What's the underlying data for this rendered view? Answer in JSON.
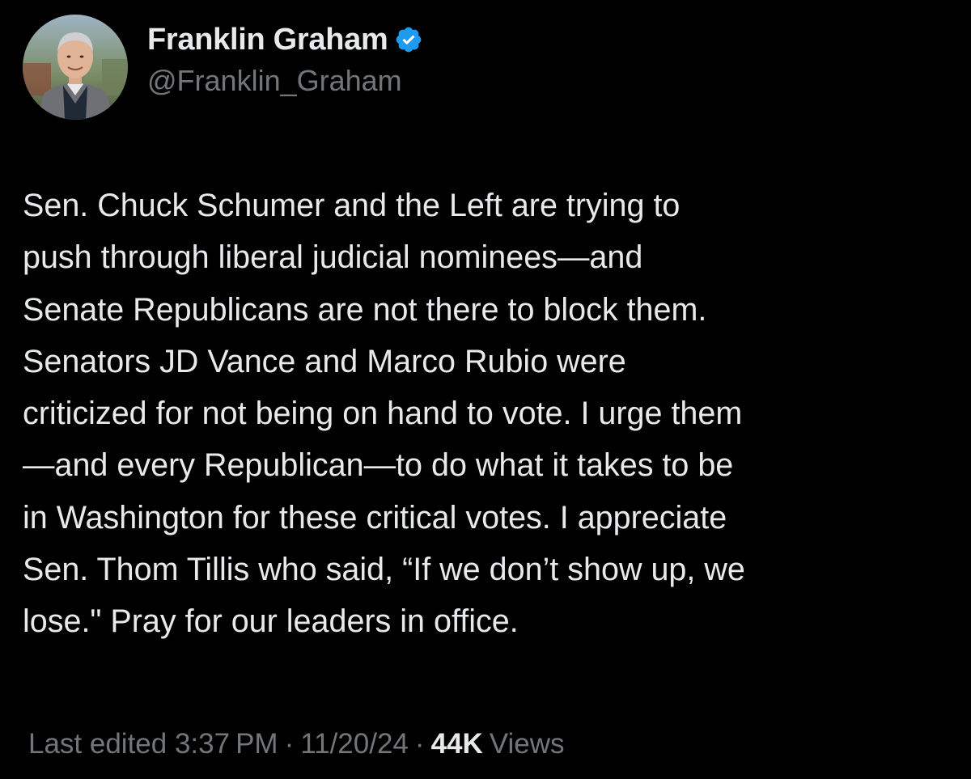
{
  "author": {
    "display_name": "Franklin Graham",
    "handle": "@Franklin_Graham",
    "verified": true,
    "verified_color": "#1d9bf0",
    "avatar_icon": "profile-photo"
  },
  "tweet": {
    "lines": [
      "Sen. Chuck Schumer and the Left are trying to",
      "push through liberal judicial nominees—and",
      "Senate Republicans are not there to block them.",
      "Senators JD Vance and Marco Rubio were",
      "criticized for not being on hand to vote. I urge them",
      "—and every Republican—to do what it takes to be",
      "in Washington for these critical votes. I appreciate",
      "Sen. Thom Tillis who said, “If we don’t show up, we",
      "lose.\" Pray for our leaders in office."
    ]
  },
  "meta": {
    "edited_label": "Last edited 3:37 PM",
    "separator": "·",
    "date": "11/20/24",
    "views_count": "44K",
    "views_label": "Views"
  },
  "colors": {
    "background": "#000000",
    "primary_text": "#e7e9ea",
    "secondary_text": "#71767b"
  }
}
